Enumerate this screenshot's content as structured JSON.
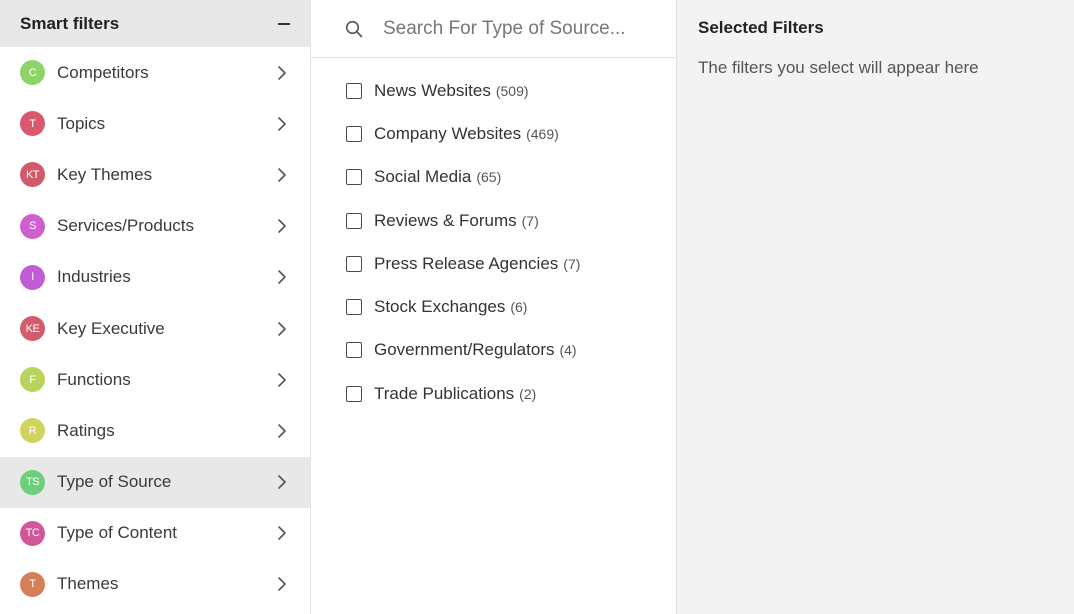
{
  "left": {
    "title": "Smart filters",
    "categories": [
      {
        "badge": "C",
        "label": "Competitors",
        "color": "#8fd36b",
        "active": false
      },
      {
        "badge": "T",
        "label": "Topics",
        "color": "#d8596e",
        "active": false
      },
      {
        "badge": "KT",
        "label": "Key Themes",
        "color": "#d05a6a",
        "active": false
      },
      {
        "badge": "S",
        "label": "Services/Products",
        "color": "#cf5fd1",
        "active": false
      },
      {
        "badge": "I",
        "label": "Industries",
        "color": "#c05cd6",
        "active": false
      },
      {
        "badge": "KE",
        "label": "Key Executive",
        "color": "#d25c6c",
        "active": false
      },
      {
        "badge": "F",
        "label": "Functions",
        "color": "#b8d45e",
        "active": false
      },
      {
        "badge": "R",
        "label": "Ratings",
        "color": "#d2d35e",
        "active": false
      },
      {
        "badge": "TS",
        "label": "Type of Source",
        "color": "#6ecf7b",
        "active": true
      },
      {
        "badge": "TC",
        "label": "Type of Content",
        "color": "#d0589a",
        "active": false
      },
      {
        "badge": "T",
        "label": "Themes",
        "color": "#d57f57",
        "active": false
      }
    ]
  },
  "middle": {
    "search_placeholder": "Search For Type of Source...",
    "options": [
      {
        "label": "News Websites",
        "count": "(509)"
      },
      {
        "label": "Company Websites",
        "count": "(469)"
      },
      {
        "label": "Social Media",
        "count": "(65)"
      },
      {
        "label": "Reviews & Forums",
        "count": "(7)"
      },
      {
        "label": "Press Release Agencies",
        "count": "(7)"
      },
      {
        "label": "Stock Exchanges",
        "count": "(6)"
      },
      {
        "label": "Government/Regulators",
        "count": "(4)"
      },
      {
        "label": "Trade Publications",
        "count": "(2)"
      }
    ]
  },
  "right": {
    "title": "Selected Filters",
    "hint": "The filters you select will appear here"
  }
}
